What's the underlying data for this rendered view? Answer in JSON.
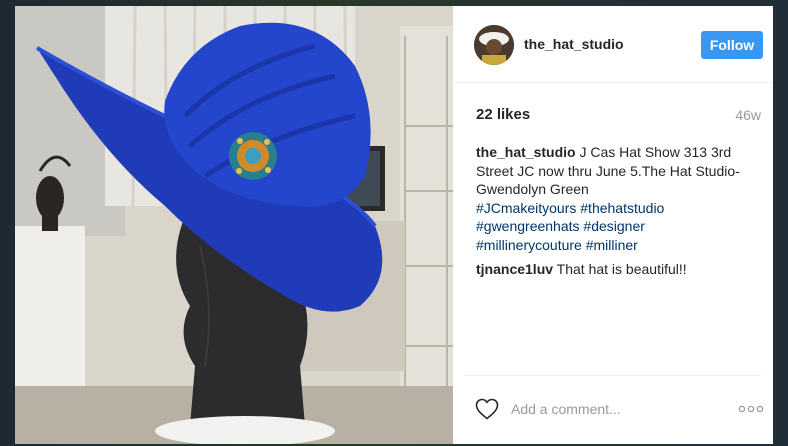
{
  "post": {
    "username": "the_hat_studio",
    "follow_label": "Follow",
    "likes": "22 likes",
    "age": "46w"
  },
  "caption": {
    "user": "the_hat_studio",
    "text": " J Cas Hat Show 313 3rd Street JC now thru June 5.The Hat Studio-Gwendolyn Green",
    "hashtags": [
      "#JCmakeityours",
      "#thehatstudio",
      "#gwengreenhats",
      "#designer",
      "#millinerycouture",
      "#milliner"
    ]
  },
  "comments": [
    {
      "user": "tjnance1luv",
      "text": " That hat is beautiful!!"
    }
  ],
  "add_comment": {
    "placeholder": "Add a comment..."
  },
  "icons": {
    "like": "heart-icon",
    "more": "more-options-icon"
  },
  "colors": {
    "follow_button": "#3897f0",
    "hashtag": "#003569",
    "hat": "#1f3fc0"
  }
}
